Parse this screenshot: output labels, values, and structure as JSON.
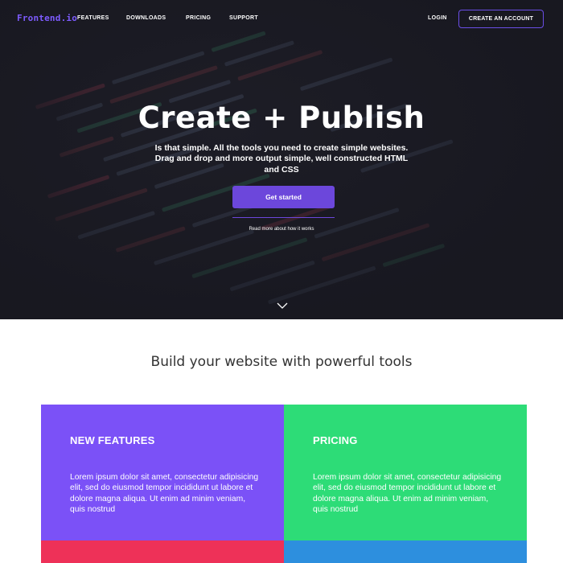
{
  "nav": {
    "logo": "Frontend.io",
    "links": [
      "FEATURES",
      "DOWNLOADS",
      "PRICING",
      "SUPPORT"
    ],
    "login": "LOGIN",
    "create_account": "CREATE AN ACCOUNT"
  },
  "hero": {
    "title": "Create + Publish",
    "subtitle": "Is that simple. All the tools you need to create simple websites. Drag and drop and more output simple, well constructed HTML and CSS",
    "cta": "Get started",
    "read_more": "Read more about how it works",
    "scroll_icon": "chevron-down-icon"
  },
  "section": {
    "title": "Build your website with powerful tools"
  },
  "cards": [
    {
      "title": "NEW FEATURES",
      "text": "Lorem ipsum dolor sit amet, consectetur adipisicing elit, sed do eiusmod tempor incididunt ut labore et dolore magna aliqua. Ut enim ad minim veniam, quis nostrud",
      "color": "#7b51f7"
    },
    {
      "title": "PRICING",
      "text": "Lorem ipsum dolor sit amet, consectetur adipisicing elit, sed do eiusmod tempor incididunt ut labore et dolore magna aliqua. Ut enim ad minim veniam, quis nostrud",
      "color": "#2ddc77"
    }
  ],
  "colors": {
    "accent": "#6c47db",
    "hero_bg": "#1d1d26",
    "card_red": "#ee3158",
    "card_blue": "#2d8fde"
  }
}
